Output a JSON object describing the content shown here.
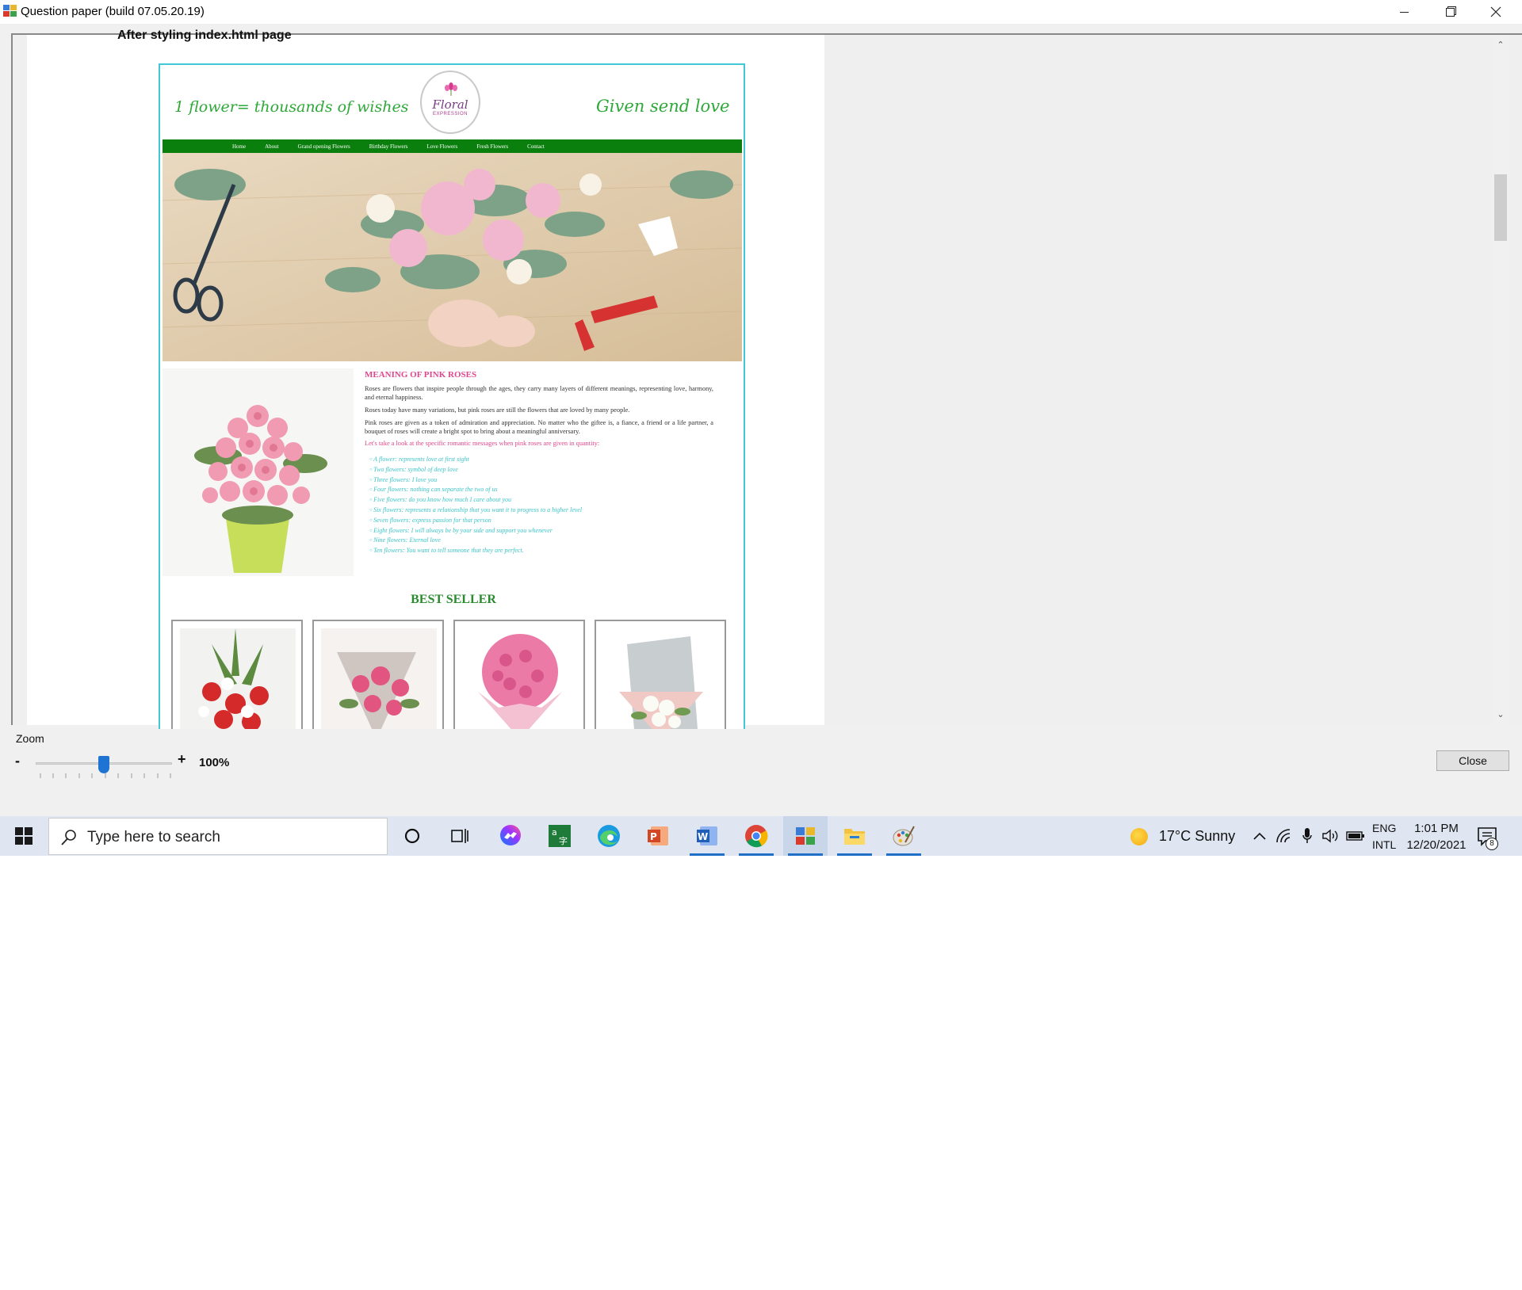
{
  "window": {
    "title": "Question paper (build 07.05.20.19)",
    "controls": {
      "minimize": "minimize",
      "maximize": "restore",
      "close": "close"
    }
  },
  "document": {
    "heading": "After styling index.html page",
    "website": {
      "slogan_left": "1 flower= thousands of wishes",
      "slogan_right": "Given send love",
      "logo_text": "Floral",
      "logo_subtext": "EXPRESSION",
      "nav": [
        "Home",
        "About",
        "Grand opening Flowers",
        "Birthday Flowers",
        "Love Flowers",
        "Fresh Flowers",
        "Contact"
      ],
      "article": {
        "title": "MEANING OF PINK ROSES",
        "paragraphs": [
          "Roses are flowers that inspire people through the ages, they carry many layers of different meanings, representing love, harmony, and eternal happiness.",
          "Roses today have many variations, but pink roses are still the flowers that are loved by many people.",
          "Pink roses are given as a token of admiration and appreciation. No matter who the giftee is, a fiance, a friend or a life partner, a bouquet of roses will create a bright spot to bring about a meaningful anniversary."
        ],
        "lead": "Let's take a look at the specific romantic messages when pink roses are given in quantity:",
        "meanings": [
          "A flower: represents love at first sight",
          "Two flowers: symbol of deep love",
          "Three flowers: I love you",
          "Four flowers: nothing can separate the two of us",
          "Five flowers: do you know how much I care about you",
          "Six flowers: represents a relationship that you want it to progress to a higher level",
          "Seven flowers: express passion for that person",
          "Eight flowers: I will always be by your side and support you whenever",
          "Nine flowers: Eternal love",
          "Ten flowers: You want to tell someone that they are perfect."
        ]
      },
      "best_seller_title": "BEST SELLER"
    }
  },
  "zoom": {
    "label": "Zoom",
    "minus": "-",
    "plus": "+",
    "value": "100%",
    "level_percent": 100
  },
  "buttons": {
    "close": "Close"
  },
  "taskbar": {
    "search_placeholder": "Type here to search",
    "weather": "17°C  Sunny",
    "language_top": "ENG",
    "language_bottom": "INTL",
    "time": "1:01 PM",
    "date": "12/20/2021",
    "notification_count": "8",
    "pinned": [
      "cortana-icon",
      "task-view-icon",
      "messenger-icon",
      "dictionary-icon",
      "edge-icon",
      "powerpoint-icon",
      "word-icon",
      "chrome-icon",
      "question-paper-icon",
      "file-explorer-icon",
      "paint-icon"
    ]
  }
}
